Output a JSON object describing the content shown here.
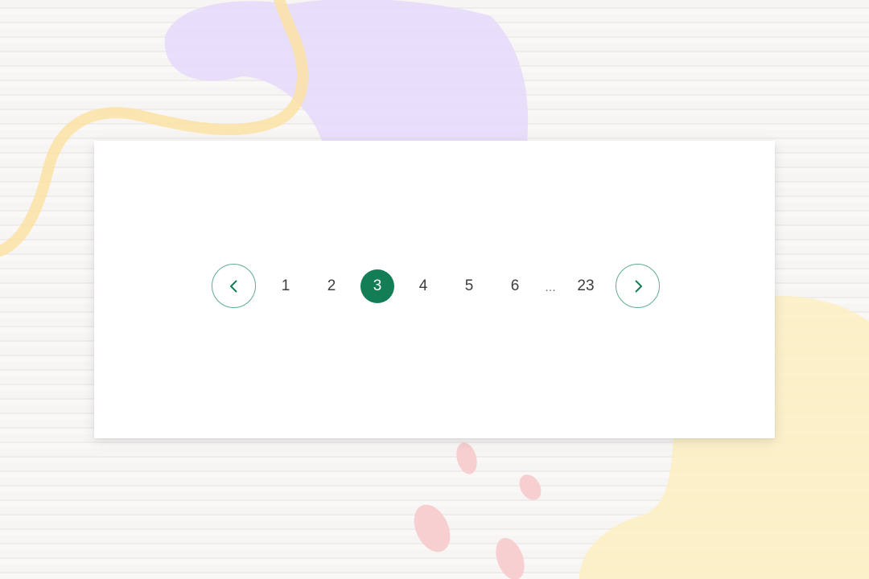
{
  "pagination": {
    "current_page": 3,
    "pages": [
      "1",
      "2",
      "3",
      "4",
      "5",
      "6"
    ],
    "ellipsis": "...",
    "last_page": "23",
    "prev_icon": "chevron-left-icon",
    "next_icon": "chevron-right-icon"
  },
  "colors": {
    "accent": "#137d55",
    "nav_border": "#5fae8c",
    "card": "#ffffff",
    "blob_purple": "#e6dcfb",
    "blob_yellow": "#fcefc4",
    "petal_pink": "#f7cfd1",
    "squiggle": "#fbe2a3"
  }
}
